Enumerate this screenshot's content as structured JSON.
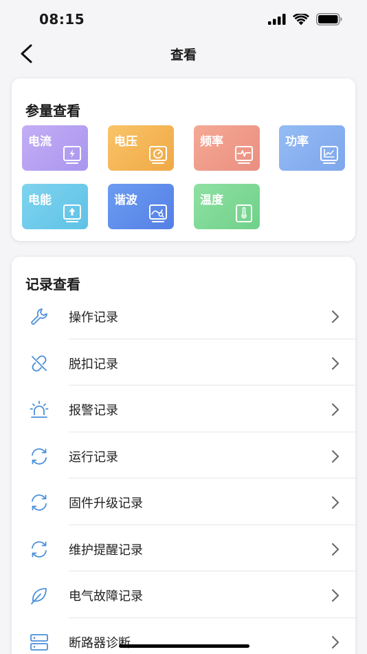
{
  "status_bar": {
    "time": "08:15"
  },
  "nav": {
    "title": "查看"
  },
  "params": {
    "title": "参量查看",
    "tiles": [
      {
        "label": "电流",
        "icon": "current-icon",
        "color_from": "#c3aef5",
        "color_to": "#a995ee"
      },
      {
        "label": "电压",
        "icon": "voltage-icon",
        "color_from": "#f8c468",
        "color_to": "#f0a846"
      },
      {
        "label": "频率",
        "icon": "frequency-icon",
        "color_from": "#f5a995",
        "color_to": "#ea8e80"
      },
      {
        "label": "功率",
        "icon": "power-icon",
        "color_from": "#94bcf4",
        "color_to": "#7ea6ec"
      },
      {
        "label": "电能",
        "icon": "energy-icon",
        "color_from": "#7fd3ee",
        "color_to": "#5ec2e6"
      },
      {
        "label": "谐波",
        "icon": "harmonic-icon",
        "color_from": "#6b9cf0",
        "color_to": "#557fe6"
      },
      {
        "label": "温度",
        "icon": "temperature-icon",
        "color_from": "#8fe0a2",
        "color_to": "#6fd189"
      }
    ]
  },
  "records": {
    "title": "记录查看",
    "items": [
      {
        "label": "操作记录",
        "icon": "wrench-icon"
      },
      {
        "label": "脱扣记录",
        "icon": "broken-link-icon"
      },
      {
        "label": "报警记录",
        "icon": "alarm-light-icon"
      },
      {
        "label": "运行记录",
        "icon": "refresh-icon"
      },
      {
        "label": "固件升级记录",
        "icon": "refresh-icon"
      },
      {
        "label": "维护提醒记录",
        "icon": "refresh-icon"
      },
      {
        "label": "电气故障记录",
        "icon": "leaf-icon"
      },
      {
        "label": "断路器诊断",
        "icon": "server-icon"
      }
    ]
  },
  "colors": {
    "accent_icon": "#4a8fd9"
  }
}
